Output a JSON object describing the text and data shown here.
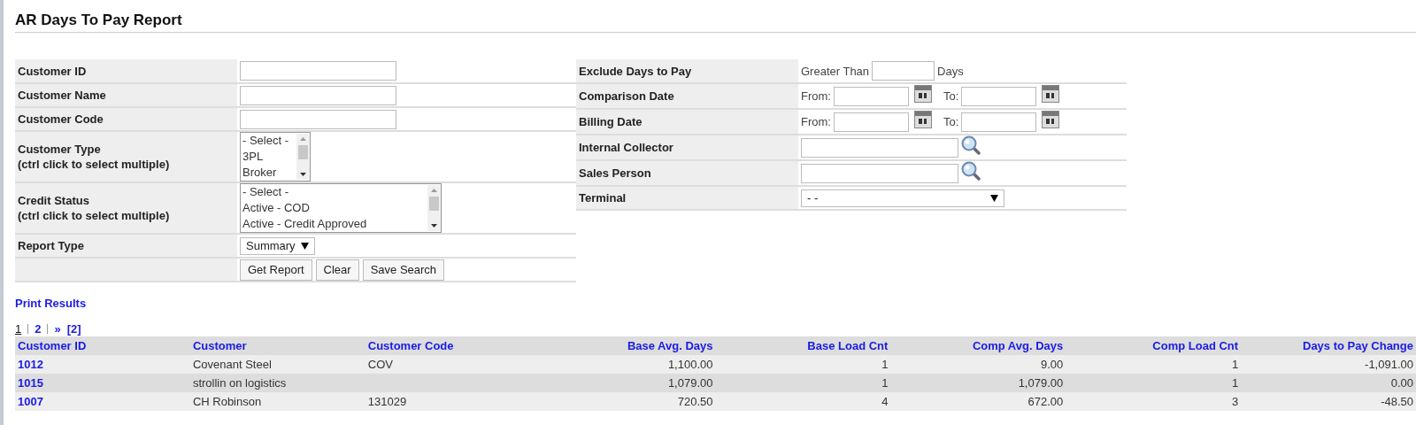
{
  "title": "AR Days To Pay Report",
  "left_form": [
    {
      "kind": "text",
      "label": "Customer ID"
    },
    {
      "kind": "text",
      "label": "Customer Name"
    },
    {
      "kind": "text",
      "label": "Customer Code"
    },
    {
      "kind": "listbox",
      "label": "Customer Type",
      "hint": "(ctrl click to select multiple)",
      "options": [
        "- Select -",
        "3PL",
        "Broker"
      ]
    },
    {
      "kind": "listbox",
      "label": "Credit Status",
      "hint": "(ctrl click to select multiple)",
      "options": [
        "- Select -",
        "Active - COD",
        "Active - Credit Approved"
      ]
    },
    {
      "kind": "select",
      "label": "Report Type",
      "value": "Summary"
    },
    {
      "kind": "buttons",
      "buttons": [
        "Get Report",
        "Clear",
        "Save Search"
      ]
    }
  ],
  "right_form": [
    {
      "kind": "number",
      "label": "Exclude Days to Pay",
      "prefix": "Greater Than",
      "suffix": "Days"
    },
    {
      "kind": "date_range",
      "label": "Comparison Date",
      "from": "From:",
      "to": "To:"
    },
    {
      "kind": "date_range",
      "label": "Billing Date",
      "from": "From:",
      "to": "To:"
    },
    {
      "kind": "lookup",
      "label": "Internal Collector"
    },
    {
      "kind": "lookup",
      "label": "Sales Person"
    },
    {
      "kind": "select",
      "label": "Terminal",
      "value": "- -"
    }
  ],
  "print_link": "Print Results",
  "pager": [
    {
      "label": "1",
      "selected": true
    },
    {
      "label": "2",
      "selected": false
    },
    {
      "label": "»",
      "selected": false
    },
    {
      "label": "[2]",
      "selected": false
    }
  ],
  "table": {
    "columns": [
      "Customer ID",
      "Customer",
      "Customer Code",
      "Base Avg. Days",
      "Base Load Cnt",
      "Comp Avg. Days",
      "Comp Load Cnt",
      "Days to Pay Change"
    ],
    "rows": [
      [
        "1012",
        "Covenant Steel",
        "COV",
        "1,100.00",
        "1",
        "9.00",
        "1",
        "-1,091.00"
      ],
      [
        "1015",
        "strollin on logistics",
        "",
        "1,079.00",
        "1",
        "1,079.00",
        "1",
        "0.00"
      ],
      [
        "1007",
        "CH Robinson",
        "131029",
        "720.50",
        "4",
        "672.00",
        "3",
        "-48.50"
      ]
    ]
  }
}
